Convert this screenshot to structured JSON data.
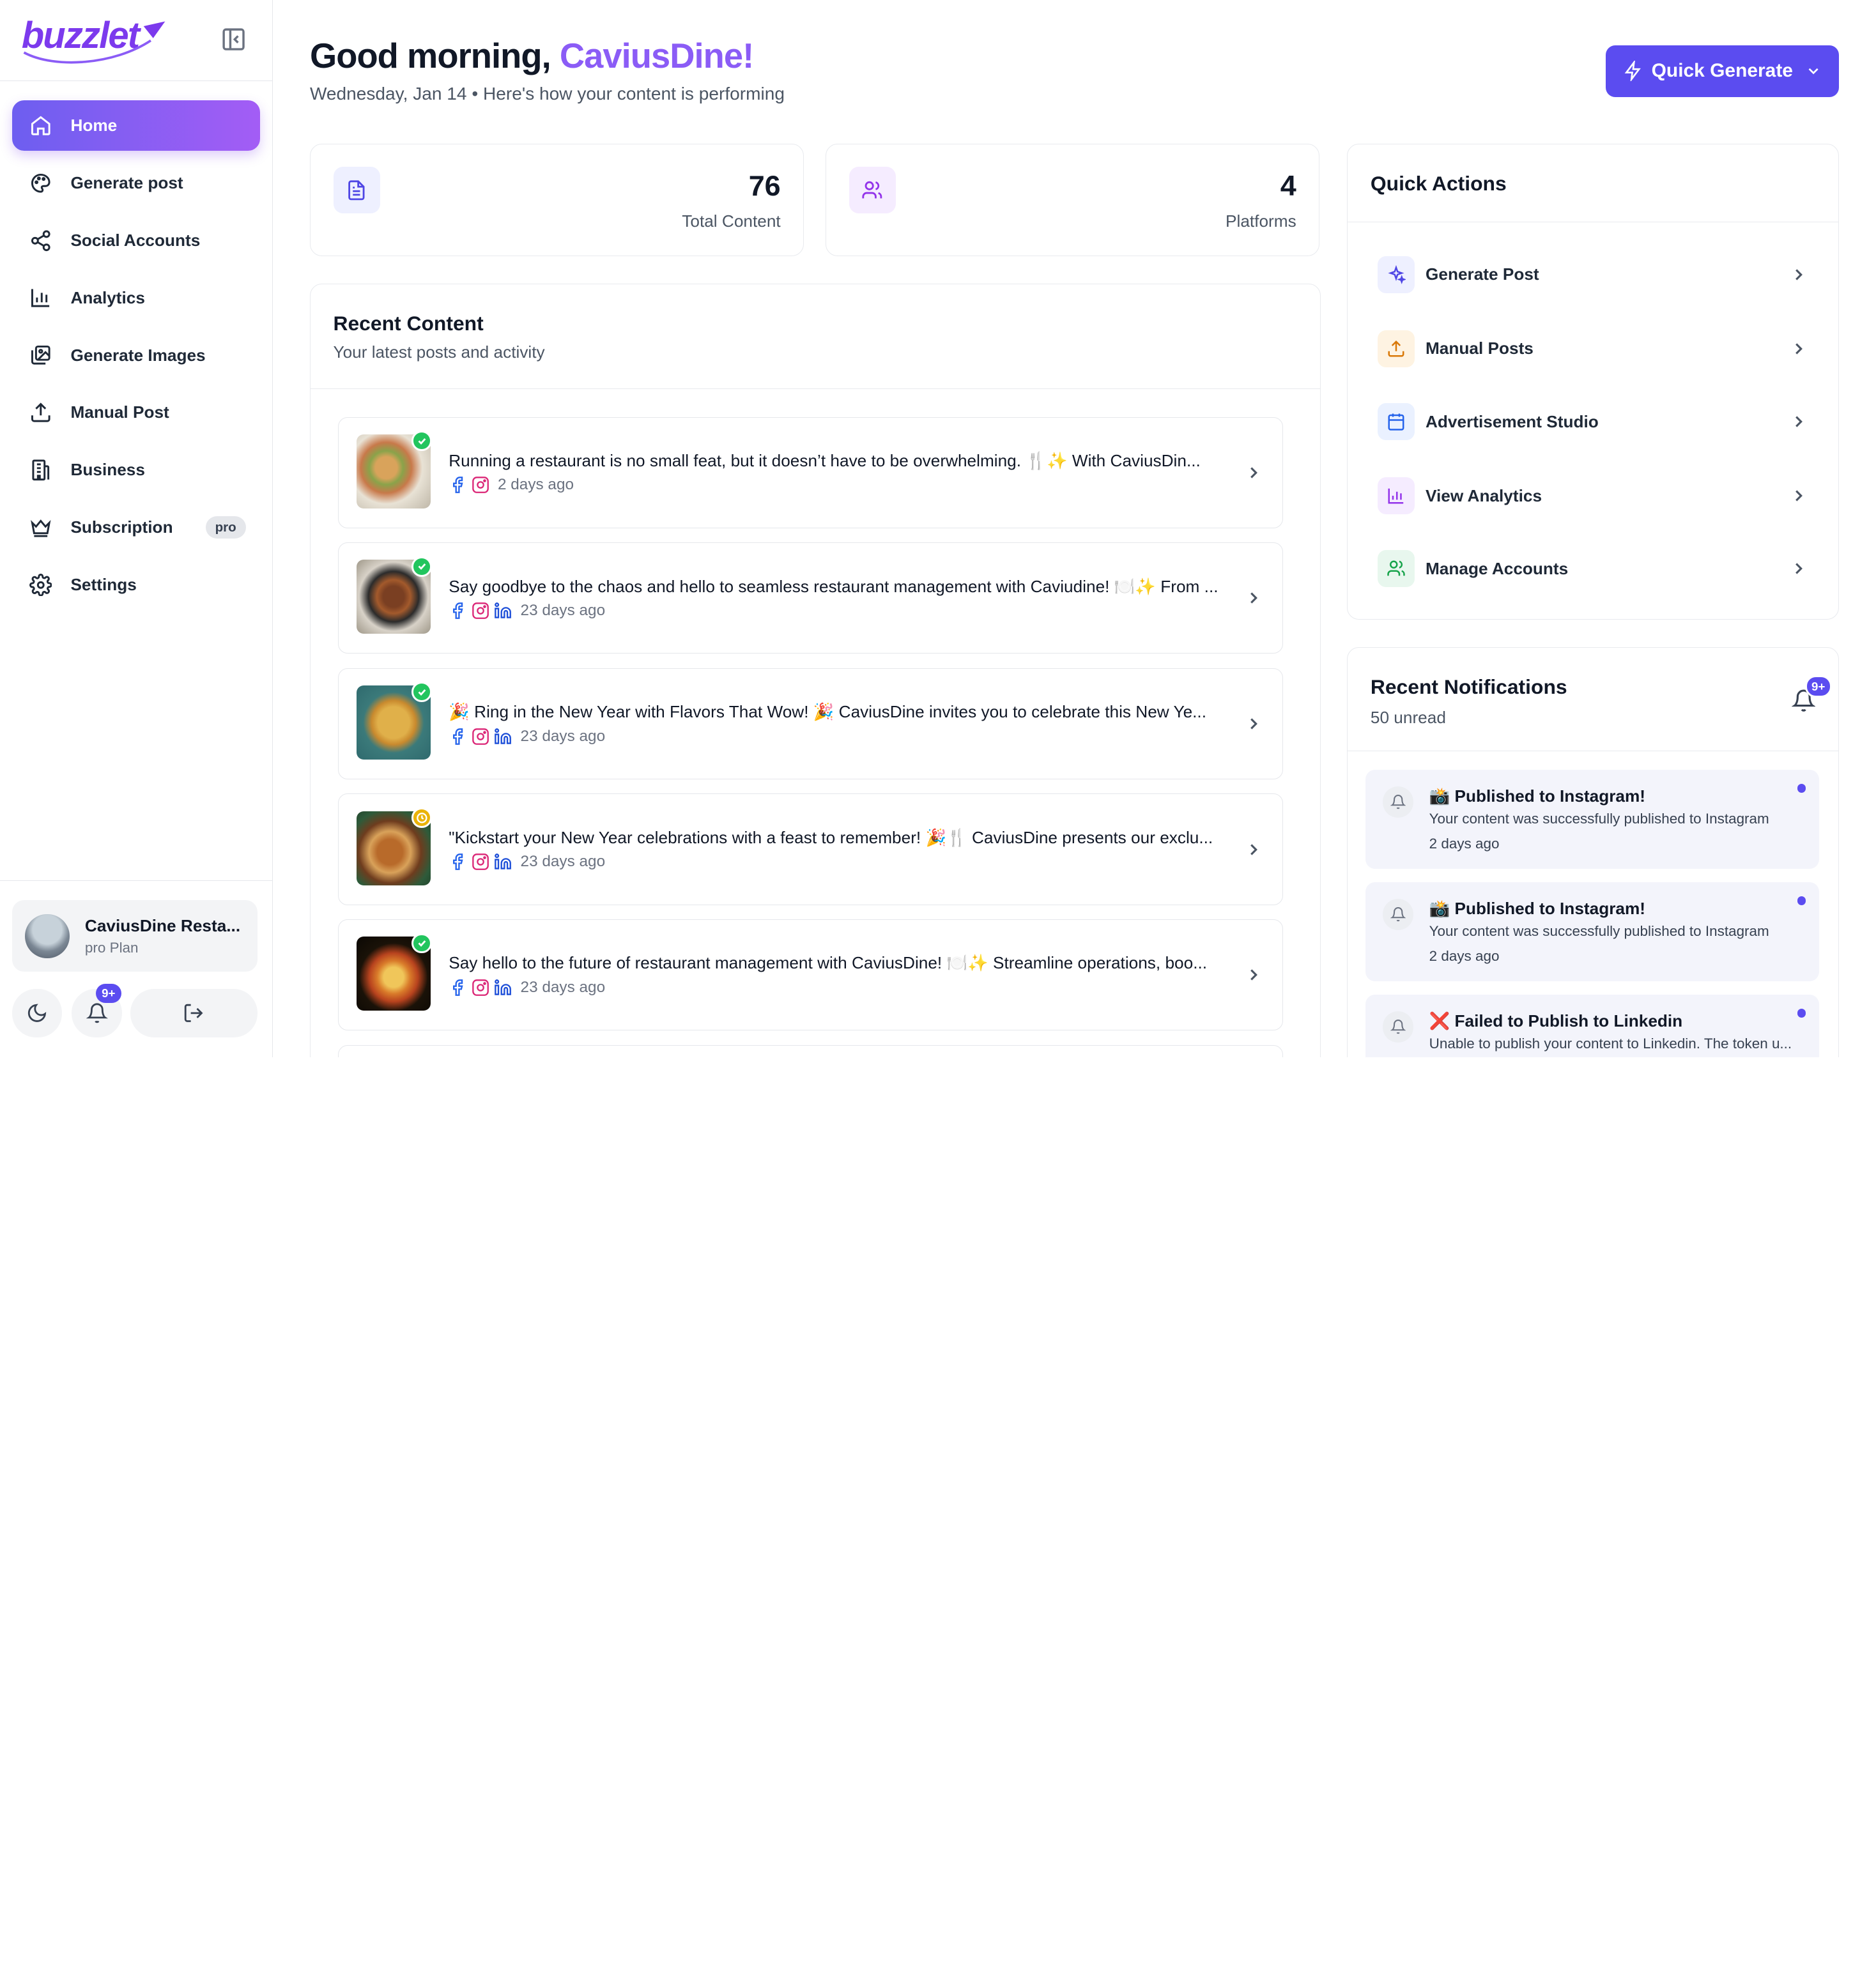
{
  "brand": {
    "logo_text": "buzzlet"
  },
  "sidebar": {
    "items": [
      {
        "label": "Home",
        "icon": "home-icon",
        "active": true
      },
      {
        "label": "Generate post",
        "icon": "palette-icon"
      },
      {
        "label": "Social Accounts",
        "icon": "share-icon"
      },
      {
        "label": "Analytics",
        "icon": "bar-chart-icon"
      },
      {
        "label": "Generate Images",
        "icon": "images-icon"
      },
      {
        "label": "Manual Post",
        "icon": "upload-icon"
      },
      {
        "label": "Business",
        "icon": "building-icon"
      },
      {
        "label": "Subscription",
        "icon": "crown-icon",
        "badge": "pro"
      },
      {
        "label": "Settings",
        "icon": "gear-icon"
      }
    ],
    "user": {
      "name": "CaviusDine Resta...",
      "plan": "pro Plan"
    },
    "notif_badge": "9+"
  },
  "header": {
    "greeting": "Good morning,",
    "name": "CaviusDine!",
    "date": "Wednesday, Jan 14",
    "subtitle": "Here's how your content is performing",
    "separator": "•",
    "quick_generate": "Quick Generate"
  },
  "stats": [
    {
      "value": "76",
      "label": "Total Content",
      "icon": "document-icon"
    },
    {
      "value": "4",
      "label": "Platforms",
      "icon": "users-icon"
    }
  ],
  "recent_content": {
    "title": "Recent Content",
    "subtitle": "Your latest posts and activity",
    "posts": [
      {
        "text": "Running a restaurant is no small feat, but it doesn’t have to be overwhelming. 🍴✨ With CaviusDin...",
        "time": "2 days ago",
        "status": "published",
        "platforms": [
          "facebook",
          "instagram"
        ]
      },
      {
        "text": "Say goodbye to the chaos and hello to seamless restaurant management with Caviudine! 🍽️✨ From ...",
        "time": "23 days ago",
        "status": "published",
        "platforms": [
          "facebook",
          "instagram",
          "linkedin"
        ]
      },
      {
        "text": "🎉 Ring in the New Year with Flavors That Wow! 🎉 CaviusDine invites you to celebrate this New Ye...",
        "time": "23 days ago",
        "status": "published",
        "platforms": [
          "facebook",
          "instagram",
          "linkedin"
        ]
      },
      {
        "text": "\"Kickstart your New Year celebrations with a feast to remember! 🎉🍴 CaviusDine presents our exclu...",
        "time": "23 days ago",
        "status": "scheduled",
        "platforms": [
          "facebook",
          "instagram",
          "linkedin"
        ]
      },
      {
        "text": "Say hello to the future of restaurant management with CaviusDine! 🍽️✨ Streamline operations, boo...",
        "time": "23 days ago",
        "status": "published",
        "platforms": [
          "facebook",
          "instagram",
          "linkedin"
        ]
      }
    ]
  },
  "quick_actions": {
    "title": "Quick Actions",
    "items": [
      {
        "label": "Generate Post",
        "icon": "sparkles-icon",
        "color": "#4f46e5",
        "bg": "#eef0ff"
      },
      {
        "label": "Manual Posts",
        "icon": "upload-icon",
        "color": "#d97706",
        "bg": "#fef3e2"
      },
      {
        "label": "Advertisement Studio",
        "icon": "calendar-icon",
        "color": "#2563eb",
        "bg": "#eaf1ff"
      },
      {
        "label": "View Analytics",
        "icon": "bar-chart-icon",
        "color": "#9333ea",
        "bg": "#f5ecff"
      },
      {
        "label": "Manage Accounts",
        "icon": "users-icon",
        "color": "#16a34a",
        "bg": "#e8f7ee"
      }
    ]
  },
  "notifications": {
    "title": "Recent Notifications",
    "unread": "50 unread",
    "badge": "9+",
    "items": [
      {
        "title": "📸 Published to Instagram!",
        "body": "Your content was successfully published to Instagram",
        "time": "2 days ago"
      },
      {
        "title": "📸 Published to Instagram!",
        "body": "Your content was successfully published to Instagram",
        "time": "2 days ago"
      },
      {
        "title": "❌ Failed to Publish to Linkedin",
        "body": "Unable to publish your content to Linkedin. The token u...",
        "time": ""
      }
    ]
  },
  "colors": {
    "accent": "#5b4cf0",
    "accent_purple": "#8b5cf6",
    "success": "#22c55e",
    "warning": "#eab308"
  }
}
